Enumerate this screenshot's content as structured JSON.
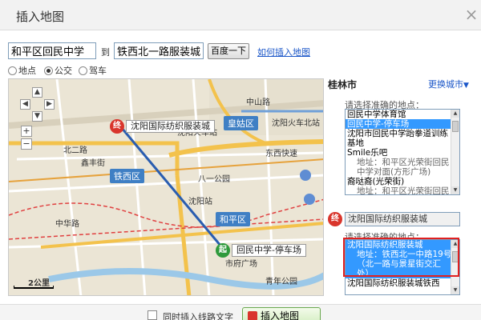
{
  "dialog": {
    "title": "插入地图",
    "close_glyph": "×"
  },
  "route": {
    "start_value": "和平区回民中学",
    "to_label": "到",
    "end_value": "铁西北一路服装城",
    "search_button": "百度一下",
    "help_link": "如何插入地图"
  },
  "modes": [
    {
      "label": "地点",
      "selected": false
    },
    {
      "label": "公交",
      "selected": true
    },
    {
      "label": "驾车",
      "selected": false
    }
  ],
  "map": {
    "nav_up": "▲",
    "nav_left": "◀",
    "nav_right": "▶",
    "nav_down": "▼",
    "zoom_in": "+",
    "zoom_out": "−",
    "districts": [
      "皇姑区",
      "铁西区",
      "和平区"
    ],
    "places": [
      "北二路",
      "中山路",
      "沈阳火车站",
      "沈阳火车北站",
      "东西快速",
      "八一公园",
      "沈阳站",
      "鑫丰街",
      "中华路",
      "市府广场",
      "青年公园"
    ],
    "end_marker_glyph": "终",
    "end_marker_label": "沈阳国际纺织服装城",
    "start_marker_glyph": "起",
    "start_marker_label": "回民中学-停车场",
    "scale": "2公里",
    "colors": {
      "start_marker": "#2f9a3c",
      "end_marker": "#d9352c",
      "district": "#3f7fc4",
      "route": "#e04040"
    }
  },
  "panel": {
    "city": "桂林市",
    "change_city": "更换城市",
    "change_city_arrow": "▼",
    "start_prompt": "请选择准确的地点：",
    "start_list": [
      {
        "text": "回民中学体育馆",
        "selected": false,
        "addr": false
      },
      {
        "text": "回民中学-停车场",
        "selected": true,
        "addr": false
      },
      {
        "text": "沈阳市回民中学跆拳道训练",
        "selected": false,
        "addr": false
      },
      {
        "text": "基地",
        "selected": false,
        "addr": false
      },
      {
        "text": "Smile乐吧",
        "selected": false,
        "addr": false
      },
      {
        "text": "地址：和平区光荣街回民",
        "selected": false,
        "addr": true
      },
      {
        "text": "中学对面(方形广场)",
        "selected": false,
        "addr": true
      },
      {
        "text": "裔哒裔(光荣街)",
        "selected": false,
        "addr": false
      },
      {
        "text": "地址：和平区光荣街回民",
        "selected": false,
        "addr": true
      }
    ],
    "end_marker_glyph": "终",
    "end_value": "沈阳国际纺织服装城",
    "end_prompt": "请选择准确的地点：",
    "end_list": [
      {
        "text": "沈阳国际纺织服装城",
        "selected": true,
        "addr": false
      },
      {
        "text": "地址：铁西北一中路19号",
        "selected": true,
        "addr": true
      },
      {
        "text": "（北一路与景星街交汇",
        "selected": true,
        "addr": true
      },
      {
        "text": "处）",
        "selected": true,
        "addr": true
      },
      {
        "text": "沈阳国际纺织服装城铁西",
        "selected": false,
        "addr": false
      }
    ]
  },
  "footer": {
    "checkbox_label": "同时插入线路文字",
    "insert_button": "插入地图"
  }
}
